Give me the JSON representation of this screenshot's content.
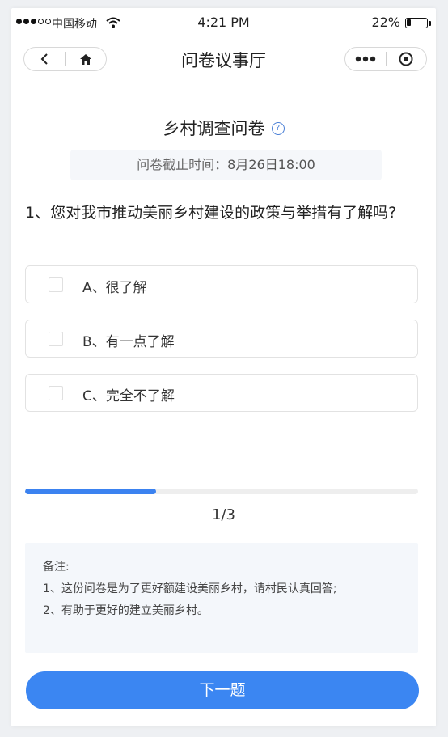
{
  "status_bar": {
    "carrier": "中国移动",
    "time": "4:21 PM",
    "battery": "22%",
    "battery_level": 0.22
  },
  "nav": {
    "title": "问卷议事厅"
  },
  "survey": {
    "title": "乡村调查问卷",
    "deadline_label": "问卷截止时间：",
    "deadline_value": "8月26日18:00"
  },
  "question": {
    "text": "1、您对我市推动美丽乡村建设的政策与举措有了解吗?",
    "options": [
      {
        "label": "A、很了解"
      },
      {
        "label": "B、有一点了解"
      },
      {
        "label": "C、完全不了解"
      }
    ]
  },
  "progress": {
    "current": 1,
    "total": 3,
    "text": "1/3"
  },
  "notes": {
    "title": "备注:",
    "lines": [
      "1、这份问卷是为了更好额建设美丽乡村，请村民认真回答;",
      "2、有助于更好的建立美丽乡村。"
    ]
  },
  "next_button": "下一题",
  "colors": {
    "accent": "#3b86f2",
    "progress": "#3b82f0",
    "help_icon": "#4a7fd6"
  }
}
